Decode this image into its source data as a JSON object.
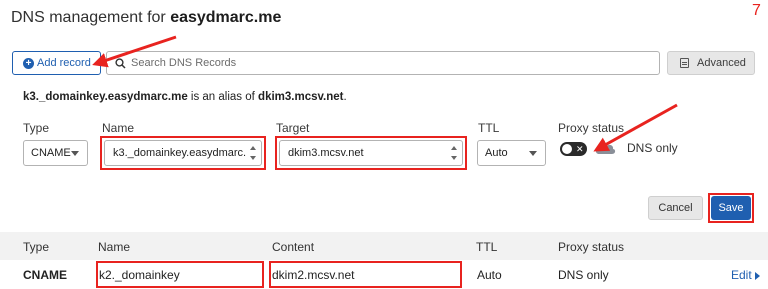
{
  "header": {
    "title_prefix": "DNS management for ",
    "domain": "easydmarc.me",
    "step_number": "7"
  },
  "toolbar": {
    "add_record_label": "Add record",
    "search_placeholder": "Search DNS Records",
    "advanced_label": "Advanced"
  },
  "alias_note": {
    "source": "k3._domainkey.easydmarc.me",
    "middle": " is an alias of ",
    "target": "dkim3.mcsv.net",
    "end": "."
  },
  "form": {
    "type_label": "Type",
    "type_value": "CNAME",
    "name_label": "Name",
    "name_value": "k3._domainkey.easydmarc.",
    "target_label": "Target",
    "target_value": "dkim3.mcsv.net",
    "ttl_label": "TTL",
    "ttl_value": "Auto",
    "proxy_label": "Proxy status",
    "proxy_toggle_glyph": "✕",
    "proxy_value": "DNS only",
    "cancel_label": "Cancel",
    "save_label": "Save"
  },
  "table": {
    "headers": {
      "type": "Type",
      "name": "Name",
      "content": "Content",
      "ttl": "TTL",
      "proxy": "Proxy status"
    },
    "rows": [
      {
        "type": "CNAME",
        "name": "k2._domainkey",
        "content": "dkim2.mcsv.net",
        "ttl": "Auto",
        "proxy": "DNS only",
        "action": "Edit"
      }
    ]
  },
  "colors": {
    "accent_blue": "#1f5fb0",
    "annotation_red": "#e8231f"
  },
  "icons": [
    "plus-circle-icon",
    "search-icon",
    "advanced-icon",
    "chevron-down-icon",
    "spinner-icon",
    "cloud-icon",
    "caret-right-icon"
  ]
}
